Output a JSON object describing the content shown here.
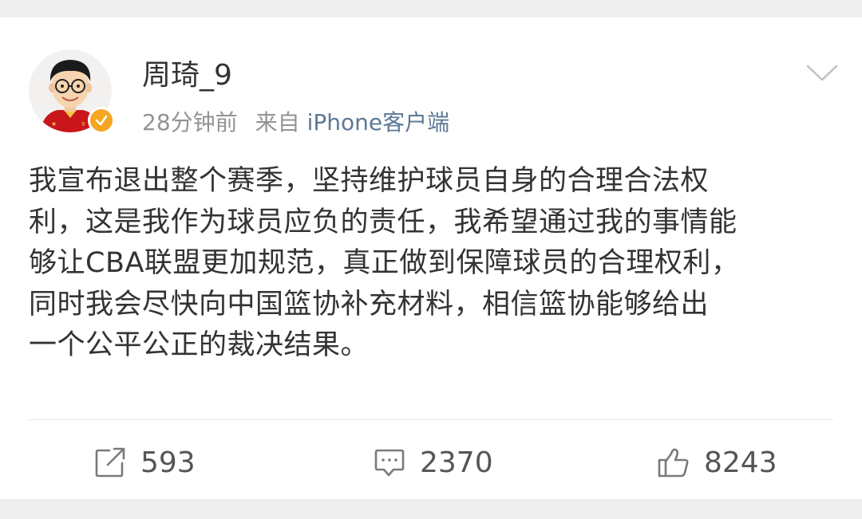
{
  "post": {
    "author": "周琦_9",
    "time": "28分钟前",
    "source_prefix": "来自",
    "source": "iPhone客户端",
    "body_lines": [
      "我宣布退出整个赛季，坚持维护球员自身的合理合法权",
      "利，这是我作为球员应负的责任，我希望通过我的事情能",
      "够让CBA联盟更加规范，真正做到保障球员的合理权利，",
      "同时我会尽快向中国篮协补充材料，相信篮协能够给出",
      "一个公平公正的裁决结果。"
    ]
  },
  "actions": {
    "repost_count": "593",
    "comment_count": "2370",
    "like_count": "8243"
  },
  "icons": {
    "repost": "repost-icon",
    "comment": "comment-icon",
    "like": "thumbs-up-icon",
    "menu": "chevron-down-icon",
    "verified": "verified-badge-icon"
  },
  "colors": {
    "background": "#eeeeee",
    "card": "#ffffff",
    "text": "#333333",
    "meta": "#939393",
    "source_link": "#5d7895",
    "verified": "#f6a623"
  }
}
